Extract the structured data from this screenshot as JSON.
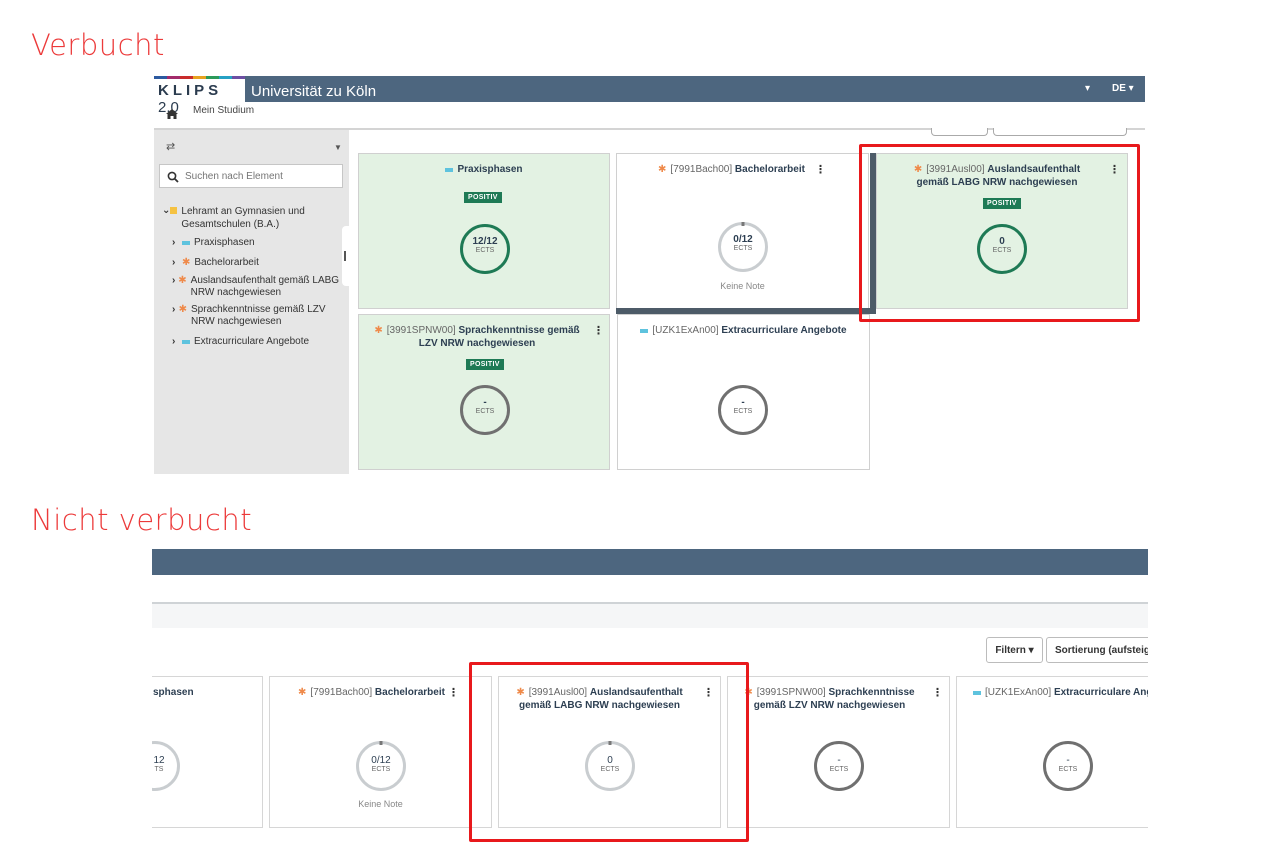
{
  "headings": {
    "booked": "Verbucht",
    "not_booked": "Nicht verbucht"
  },
  "header": {
    "logo": "KLIPS",
    "version": "2.0",
    "university": "Universität zu Köln",
    "lang": "DE",
    "breadcrumb": "Mein Studium"
  },
  "sidebar": {
    "search_placeholder": "Suchen nach Element",
    "root": "Lehramt an Gymnasien und Gesamtschulen (B.A.)",
    "items": [
      {
        "label": "Praxisphasen"
      },
      {
        "label": "Bachelorarbeit"
      },
      {
        "label": "Auslandsaufenthalt gemäß LABG NRW nachgewiesen"
      },
      {
        "label": "Sprachkenntnisse gemäß LZV NRW nachgewiesen"
      },
      {
        "label": "Extracurriculare Angebote"
      }
    ]
  },
  "cards_top": {
    "praxis": {
      "title": "Praxisphasen",
      "badge": "POSITIV",
      "value": "12/12",
      "unit": "ECTS"
    },
    "bachelor": {
      "code": "[7991Bach00]",
      "title": "Bachelorarbeit",
      "value": "0/12",
      "unit": "ECTS",
      "note": "Keine Note"
    },
    "ausland": {
      "code": "[3991Ausl00]",
      "title": "Auslandsaufenthalt gemäß LABG NRW nachgewiesen",
      "badge": "POSITIV",
      "value": "0",
      "unit": "ECTS"
    },
    "sprach": {
      "code": "[3991SPNW00]",
      "title": "Sprachkenntnisse gemäß LZV NRW nachgewiesen",
      "badge": "POSITIV",
      "value": "-",
      "unit": "ECTS"
    },
    "extra": {
      "code": "[UZK1ExAn00]",
      "title": "Extracurriculare Angebote",
      "value": "-",
      "unit": "ECTS"
    }
  },
  "toolbar2": {
    "filter": "Filtern",
    "sort": "Sortierung (aufsteigen"
  },
  "cards_bottom": {
    "praxis": {
      "title": "sphasen",
      "value": "12",
      "unit": "TS"
    },
    "bachelor": {
      "code": "[7991Bach00]",
      "title": "Bachelorarbeit",
      "value": "0/12",
      "unit": "ECTS",
      "note": "Keine Note"
    },
    "ausland": {
      "code": "[3991Ausl00]",
      "title": "Auslandsaufenthalt gemäß LABG NRW nachgewiesen",
      "value": "0",
      "unit": "ECTS"
    },
    "sprach": {
      "code": "[3991SPNW00]",
      "title": "Sprachkenntnisse gemäß LZV NRW nachgewiesen",
      "value": "-",
      "unit": "ECTS"
    },
    "extra": {
      "code": "[UZK1ExAn00]",
      "title": "Extracurriculare Angeb",
      "value": "-",
      "unit": "ECTS"
    }
  },
  "colors": {
    "header": "#4d667f",
    "positive": "#1e7a55",
    "card_green": "#e3f2e3",
    "highlight": "#e8191c",
    "heading": "#ec3a3a"
  }
}
